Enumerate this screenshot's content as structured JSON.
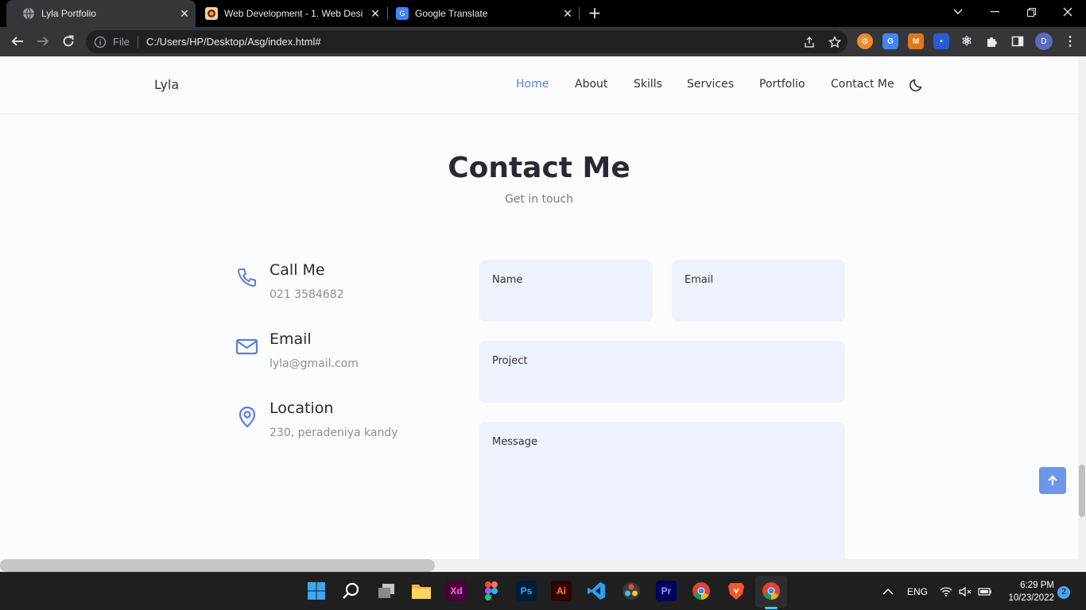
{
  "browser": {
    "tabs": [
      {
        "title": "Lyla Portfolio",
        "favicon": "globe-icon",
        "active": true
      },
      {
        "title": "Web Development - 1. Web Desi",
        "favicon": "university-logo-icon",
        "active": false
      },
      {
        "title": "Google Translate",
        "favicon": "google-translate-icon",
        "active": false
      }
    ],
    "address": {
      "scheme_label": "File",
      "url": "C:/Users/HP/Desktop/Asg/index.html#"
    },
    "profile_initial": "D"
  },
  "site": {
    "logo": "Lyla",
    "nav": [
      "Home",
      "About",
      "Skills",
      "Services",
      "Portfolio",
      "Contact Me"
    ],
    "active_nav": "Home"
  },
  "contact": {
    "title": "Contact Me",
    "subtitle": "Get in touch",
    "info": [
      {
        "heading": "Call Me",
        "value": "021 3584682",
        "icon": "phone-icon"
      },
      {
        "heading": "Email",
        "value": "lyla@gmail.com",
        "icon": "mail-icon"
      },
      {
        "heading": "Location",
        "value": "230, peradeniya kandy",
        "icon": "map-pin-icon"
      }
    ],
    "form": {
      "name_label": "Name",
      "email_label": "Email",
      "project_label": "Project",
      "message_label": "Message"
    }
  },
  "taskbar": {
    "apps": [
      "Windows Start",
      "Search",
      "Task View",
      "File Explorer",
      "Adobe XD",
      "Figma",
      "Photoshop",
      "Illustrator",
      "VS Code",
      "DaVinci Resolve",
      "Premiere Pro",
      "Chrome",
      "Brave",
      "Chrome"
    ],
    "app_labels": {
      "xd": "Xd",
      "ps": "Ps",
      "ai": "Ai",
      "pr": "Pr"
    },
    "language": "ENG",
    "time": "6:29 PM",
    "date": "10/23/2022",
    "notifications": "2"
  },
  "colors": {
    "accent": "#5b7fd9",
    "field_bg": "#eef2fc",
    "page_bg": "#fbfcfe"
  }
}
